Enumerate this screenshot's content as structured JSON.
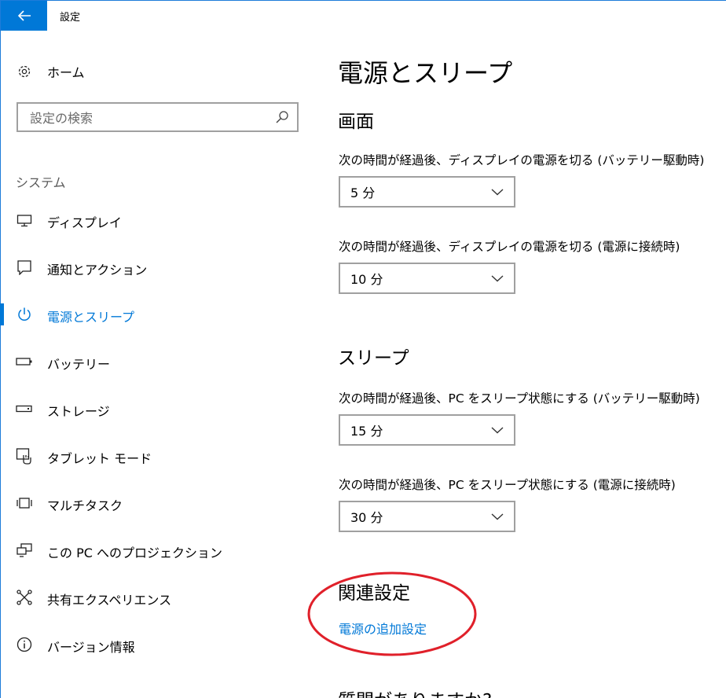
{
  "window": {
    "title": "設定",
    "accent_color": "#0078d7"
  },
  "sidebar": {
    "home_label": "ホーム",
    "search_placeholder": "設定の検索",
    "group_label": "システム",
    "items": [
      {
        "label": "ディスプレイ",
        "icon": "monitor-icon"
      },
      {
        "label": "通知とアクション",
        "icon": "notification-icon"
      },
      {
        "label": "電源とスリープ",
        "icon": "power-icon",
        "selected": true
      },
      {
        "label": "バッテリー",
        "icon": "battery-icon"
      },
      {
        "label": "ストレージ",
        "icon": "storage-icon"
      },
      {
        "label": "タブレット モード",
        "icon": "tablet-mode-icon"
      },
      {
        "label": "マルチタスク",
        "icon": "multitask-icon"
      },
      {
        "label": "この PC へのプロジェクション",
        "icon": "projection-icon"
      },
      {
        "label": "共有エクスペリエンス",
        "icon": "shared-experience-icon"
      },
      {
        "label": "バージョン情報",
        "icon": "info-icon"
      }
    ]
  },
  "main": {
    "title": "電源とスリープ",
    "screen": {
      "title": "画面",
      "battery_label": "次の時間が経過後、ディスプレイの電源を切る (バッテリー駆動時)",
      "battery_value": "5 分",
      "plugged_label": "次の時間が経過後、ディスプレイの電源を切る (電源に接続時)",
      "plugged_value": "10 分"
    },
    "sleep": {
      "title": "スリープ",
      "battery_label": "次の時間が経過後、PC をスリープ状態にする (バッテリー駆動時)",
      "battery_value": "15 分",
      "plugged_label": "次の時間が経過後、PC をスリープ状態にする (電源に接続時)",
      "plugged_value": "30 分"
    },
    "related": {
      "title": "関連設定",
      "link": "電源の追加設定"
    },
    "question_title": "質問がありますか?"
  },
  "annotation": {
    "color": "#e0202a"
  }
}
